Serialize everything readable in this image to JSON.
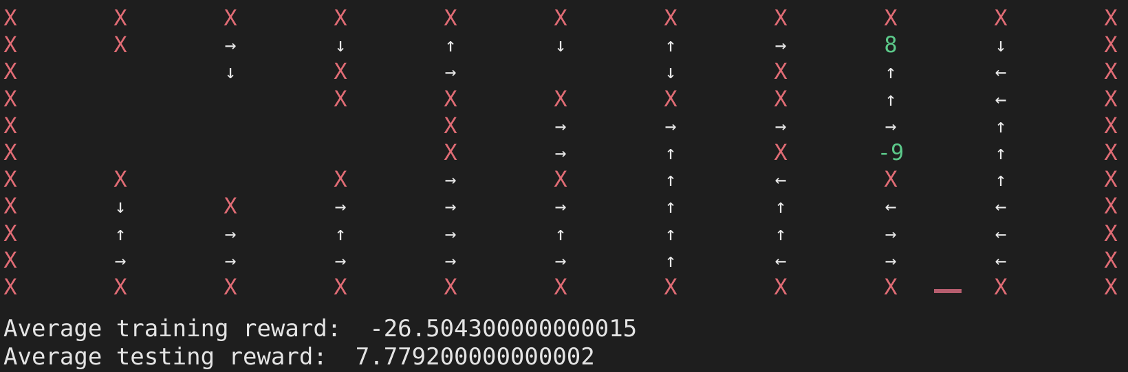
{
  "window": {
    "type": "terminal"
  },
  "grid": {
    "rows": [
      [
        "X",
        "X",
        "X",
        "X",
        "X",
        "X",
        "X",
        "X",
        "X",
        "X",
        "X"
      ],
      [
        "X",
        "X",
        "→",
        "↓",
        "↑",
        "↓",
        "↑",
        "→",
        "8",
        "↓",
        "X"
      ],
      [
        "X",
        "",
        "↓",
        "X",
        "→",
        "",
        "↓",
        "X",
        "↑",
        "←",
        "X"
      ],
      [
        "X",
        "",
        "",
        "X",
        "X",
        "X",
        "X",
        "X",
        "↑",
        "←",
        "X"
      ],
      [
        "X",
        "",
        "",
        "",
        "X",
        "→",
        "→",
        "→",
        "→",
        "↑",
        "X"
      ],
      [
        "X",
        "",
        "",
        "",
        "X",
        "→",
        "↑",
        "X",
        "-9",
        "↑",
        "X"
      ],
      [
        "X",
        "X",
        "",
        "X",
        "→",
        "X",
        "↑",
        "←",
        "X",
        "↑",
        "X"
      ],
      [
        "X",
        "↓",
        "X",
        "→",
        "→",
        "→",
        "↑",
        "↑",
        "←",
        "←",
        "X"
      ],
      [
        "X",
        "↑",
        "→",
        "↑",
        "→",
        "↑",
        "↑",
        "↑",
        "→",
        "←",
        "X"
      ],
      [
        "X",
        "→",
        "→",
        "→",
        "→",
        "→",
        "↑",
        "←",
        "→",
        "←",
        "X"
      ],
      [
        "X",
        "X",
        "X",
        "X",
        "X",
        "X",
        "X",
        "X",
        "X",
        "X",
        "X"
      ]
    ]
  },
  "output": {
    "training_label": "Average training reward:  ",
    "training_value": "-26.504300000000015",
    "testing_label": "Average testing reward:  ",
    "testing_value": "7.779200000000002"
  },
  "colors": {
    "background": "#1e1e1e",
    "wall": "#e06c75",
    "arrow": "#e8e8e8",
    "number": "#5cc98a",
    "text": "#e4e4e4",
    "cursor": "#b65d6e"
  }
}
